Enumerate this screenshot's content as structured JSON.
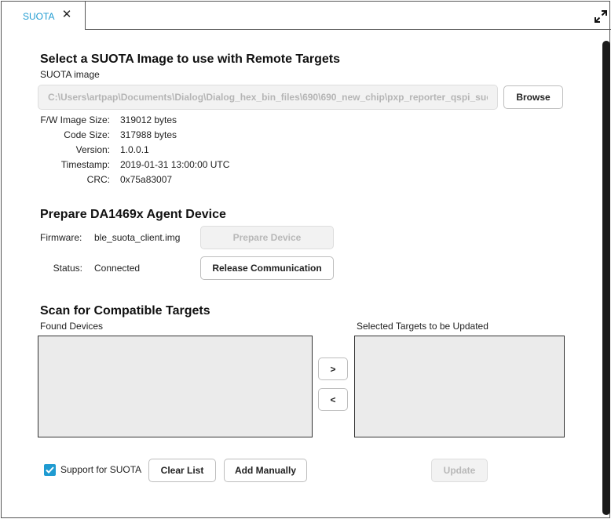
{
  "tab": {
    "label": "SUOTA",
    "close_glyph": "✕"
  },
  "image_section": {
    "title": "Select a SUOTA Image to use with Remote Targets",
    "image_label": "SUOTA image",
    "image_path": "C:\\Users\\artpap\\Documents\\Dialog\\Dialog_hex_bin_files\\690\\690_new_chip\\pxp_reporter_qspi_suota.img",
    "browse_label": "Browse",
    "details": [
      {
        "label": "F/W Image Size:",
        "value": "319012 bytes"
      },
      {
        "label": "Code Size:",
        "value": "317988 bytes"
      },
      {
        "label": "Version:",
        "value": "1.0.0.1"
      },
      {
        "label": "Timestamp:",
        "value": "2019-01-31 13:00:00 UTC"
      },
      {
        "label": "CRC:",
        "value": "0x75a83007"
      }
    ]
  },
  "agent_section": {
    "title": "Prepare DA1469x Agent Device",
    "firmware_label": "Firmware:",
    "firmware_value": "ble_suota_client.img",
    "prepare_label": "Prepare Device",
    "status_label": "Status:",
    "status_value": "Connected",
    "release_label": "Release Communication"
  },
  "scan_section": {
    "title": "Scan for Compatible Targets",
    "found_label": "Found Devices",
    "selected_label": "Selected Targets to be Updated",
    "add_glyph": ">",
    "remove_glyph": "<",
    "support_label": "Support for SUOTA",
    "support_checked": true,
    "clear_label": "Clear List",
    "add_manually_label": "Add Manually",
    "update_label": "Update"
  },
  "colors": {
    "accent": "#1f9bd1",
    "disabled_text": "#b8b8b8",
    "list_bg": "#ebebeb"
  },
  "icons": {
    "expand": "expand-arrows-icon",
    "check": "checkmark-icon"
  }
}
